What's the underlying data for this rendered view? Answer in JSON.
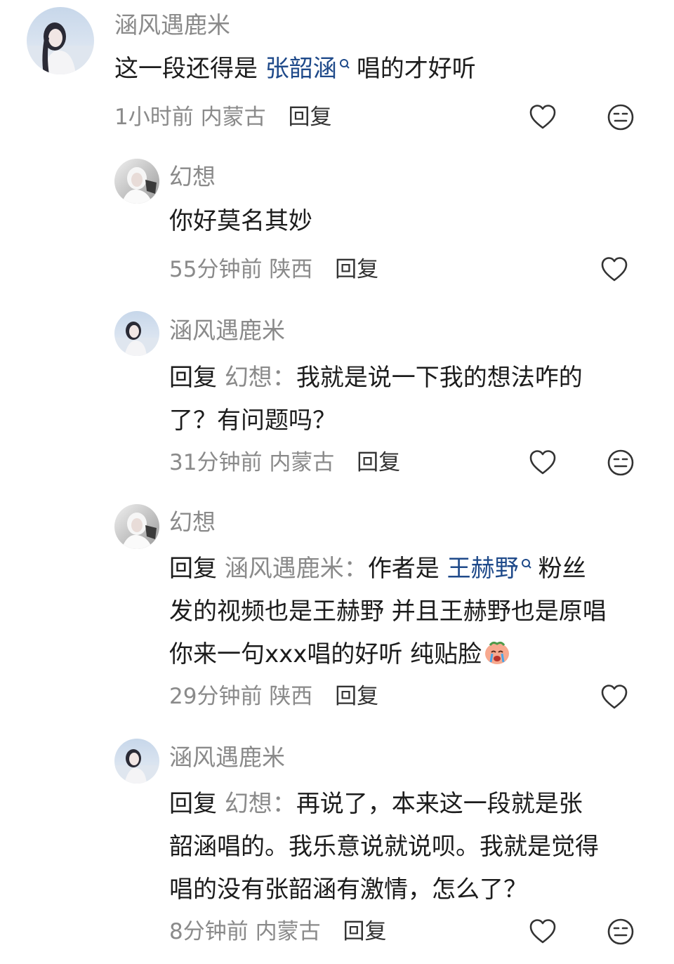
{
  "comments": [
    {
      "author": "涵风遇鹿米",
      "parts": {
        "pre": "这一段还得是 ",
        "mention": "张韶涵",
        "post": "唱的才好听"
      },
      "time": "1小时前",
      "location": "内蒙古",
      "reply_label": "回复"
    },
    {
      "author": "幻想",
      "text": "你好莫名其妙",
      "time": "55分钟前",
      "location": "陕西",
      "reply_label": "回复"
    },
    {
      "author": "涵风遇鹿米",
      "reply_prefix": "回复",
      "reply_to": "幻想：",
      "line1": "我就是说一下我的想法咋的",
      "line2": "了？有问题吗？",
      "time": "31分钟前",
      "location": "内蒙古",
      "reply_label": "回复"
    },
    {
      "author": "幻想",
      "reply_prefix": "回复",
      "reply_to": "涵风遇鹿米：",
      "line1_pre": "作者是 ",
      "mention": "王赫野",
      "line1_post": "粉丝",
      "line2": "发的视频也是王赫野 并且王赫野也是原唱",
      "line3": "你来一句xxx唱的好听 纯贴脸",
      "time": "29分钟前",
      "location": "陕西",
      "reply_label": "回复"
    },
    {
      "author": "涵风遇鹿米",
      "reply_prefix": "回复",
      "reply_to": "幻想：",
      "line1": "再说了，本来这一段就是张",
      "line2": "韶涵唱的。我乐意说就说呗。我就是觉得",
      "line3": "唱的没有张韶涵有激情，怎么了？",
      "time": "8分钟前",
      "location": "内蒙古",
      "reply_label": "回复"
    }
  ],
  "icons": {
    "like": "heart-outline-icon",
    "dislike": "neutral-face-icon",
    "mention": "search-icon",
    "emoji": "crying-face-emoji"
  },
  "colors": {
    "mention": "#1f4a8a",
    "meta": "#8a8a8a",
    "text": "#1c1c1c"
  }
}
